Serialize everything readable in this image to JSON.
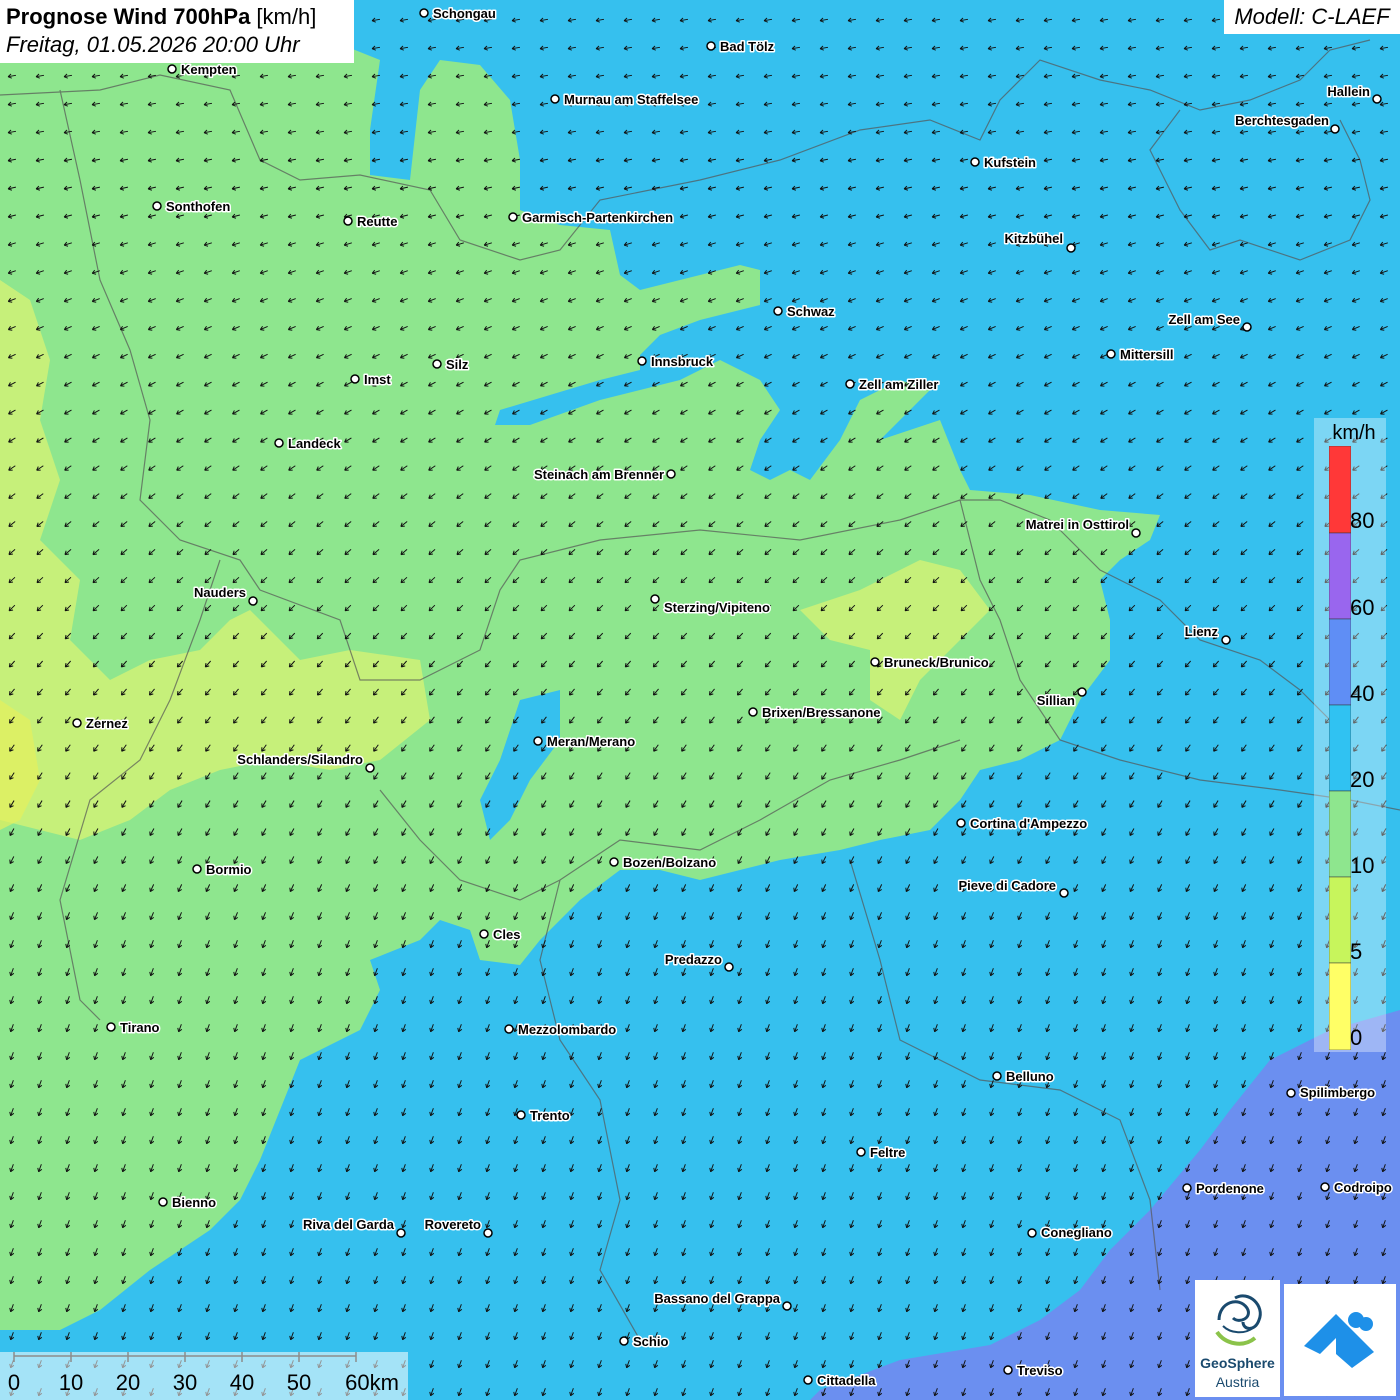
{
  "header": {
    "title_bold": "Prognose Wind 700hPa",
    "title_unit": " [km/h]",
    "subtitle": "Freitag, 01.05.2026 20:00 Uhr",
    "model": "Modell: C-LAEF"
  },
  "colors": {
    "background_blue": "#36c0ee",
    "green": "#8ee68e",
    "yellow_green": "#c6f07a",
    "purple_blue": "#6b8ff0"
  },
  "legend": {
    "unit": "km/h",
    "labels": [
      "80",
      "60",
      "40",
      "20",
      "10",
      "5",
      "0"
    ],
    "colors": [
      "#ff3838",
      "#9966ee",
      "#5f8ef5",
      "#30c2f2",
      "#8ee68e",
      "#c7f55c",
      "#ffff66"
    ]
  },
  "scale_bar": {
    "labels": [
      "0",
      "10",
      "20",
      "30",
      "40",
      "50",
      "60km"
    ]
  },
  "logo": {
    "name_line1": "GeoSphere",
    "name_line2": "Austria"
  },
  "cities": [
    {
      "name": "Schongau"
    },
    {
      "name": "Bad Tölz"
    },
    {
      "name": "Kempten"
    },
    {
      "name": "Murnau am Staffelsee"
    },
    {
      "name": "Hallein"
    },
    {
      "name": "Berchtesgaden"
    },
    {
      "name": "Kufstein"
    },
    {
      "name": "Sonthofen"
    },
    {
      "name": "Reutte"
    },
    {
      "name": "Garmisch-Partenkirchen"
    },
    {
      "name": "Kitzbühel"
    },
    {
      "name": "Schwaz"
    },
    {
      "name": "Zell am See"
    },
    {
      "name": "Mittersill"
    },
    {
      "name": "Innsbruck"
    },
    {
      "name": "Silz"
    },
    {
      "name": "Imst"
    },
    {
      "name": "Zell am Ziller"
    },
    {
      "name": "Landeck"
    },
    {
      "name": "Steinach am Brenner"
    },
    {
      "name": "Matrei in Osttirol"
    },
    {
      "name": "Nauders"
    },
    {
      "name": "Sterzing/Vipiteno"
    },
    {
      "name": "Lienz"
    },
    {
      "name": "Bruneck/Brunico"
    },
    {
      "name": "Sillian"
    },
    {
      "name": "Zernez"
    },
    {
      "name": "Brixen/Bressanone"
    },
    {
      "name": "Meran/Merano"
    },
    {
      "name": "Schlanders/Silandro"
    },
    {
      "name": "Cortina d'Ampezzo"
    },
    {
      "name": "Bozen/Bolzano"
    },
    {
      "name": "Bormio"
    },
    {
      "name": "Pieve di Cadore"
    },
    {
      "name": "Cles"
    },
    {
      "name": "Predazzo"
    },
    {
      "name": "Tirano"
    },
    {
      "name": "Mezzolombardo"
    },
    {
      "name": "Belluno"
    },
    {
      "name": "Spilimbergo"
    },
    {
      "name": "Trento"
    },
    {
      "name": "Feltre"
    },
    {
      "name": "Pordenone"
    },
    {
      "name": "Codroipo"
    },
    {
      "name": "Bienno"
    },
    {
      "name": "Riva del Garda"
    },
    {
      "name": "Rovereto"
    },
    {
      "name": "Conegliano"
    },
    {
      "name": "Bassano del Grappa"
    },
    {
      "name": "Schio"
    },
    {
      "name": "Treviso"
    },
    {
      "name": "Cittadella"
    }
  ]
}
